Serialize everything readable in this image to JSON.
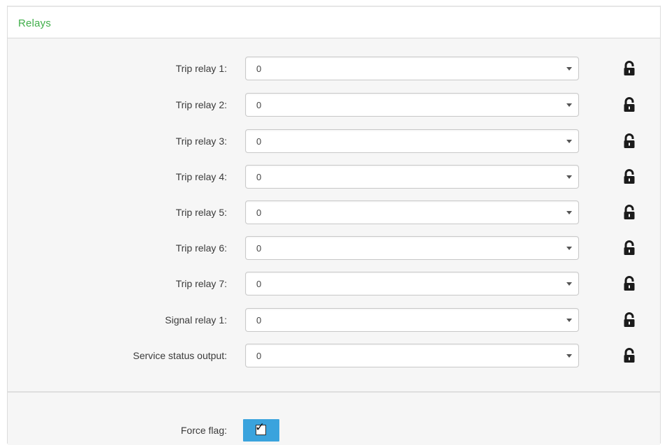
{
  "panel": {
    "title": "Relays"
  },
  "relays": [
    {
      "label": "Trip relay 1:",
      "value": "0"
    },
    {
      "label": "Trip relay 2:",
      "value": "0"
    },
    {
      "label": "Trip relay 3:",
      "value": "0"
    },
    {
      "label": "Trip relay 4:",
      "value": "0"
    },
    {
      "label": "Trip relay 5:",
      "value": "0"
    },
    {
      "label": "Trip relay 6:",
      "value": "0"
    },
    {
      "label": "Trip relay 7:",
      "value": "0"
    },
    {
      "label": "Signal relay 1:",
      "value": "0"
    },
    {
      "label": "Service status output:",
      "value": "0"
    }
  ],
  "force_flag": {
    "label": "Force flag:",
    "checked": true,
    "check_glyph": "✓"
  },
  "icons": {
    "lock": "lock-icon",
    "caret": "chevron-down-icon",
    "checkmark": "check-icon"
  },
  "colors": {
    "title_green": "#3fae49",
    "checkbox_blue": "#3aa3dd"
  }
}
